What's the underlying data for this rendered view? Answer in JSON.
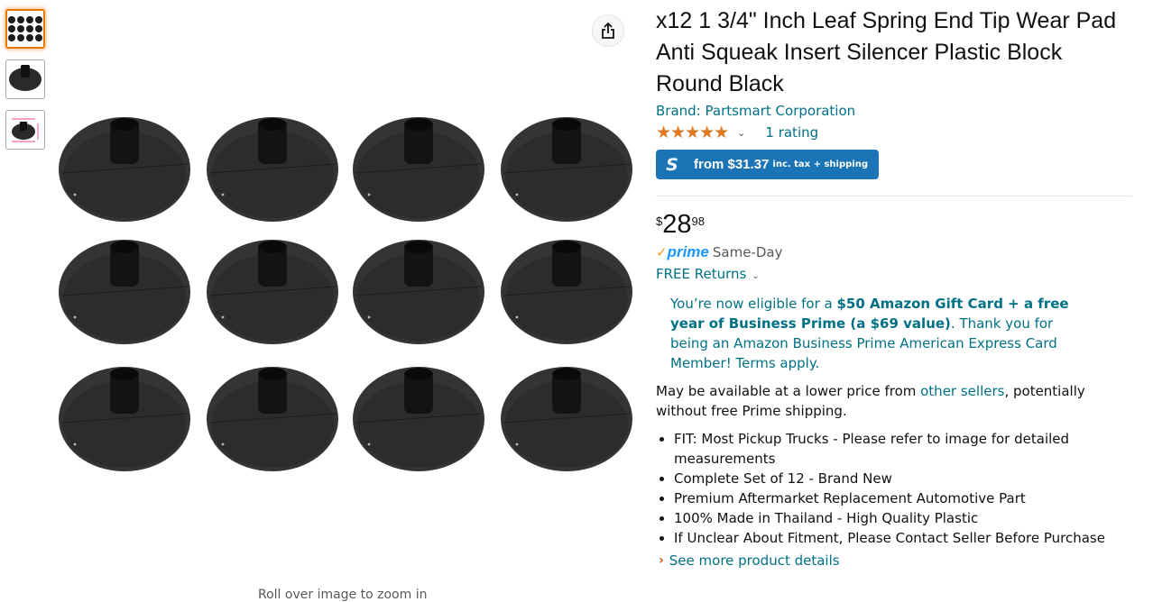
{
  "gallery": {
    "thumbnails": [
      "grid-of-pads",
      "single-pad",
      "pad-with-dimensions"
    ],
    "rollover_hint": "Roll over image to zoom in"
  },
  "product": {
    "title": "x12 1 3/4\" Inch Leaf Spring End Tip Wear Pad Anti Squeak Insert Silencer Plastic Block Round Black",
    "brand": "Brand: Partsmart Corporation",
    "stars": "★★★★★",
    "rating_value": 5,
    "rating_count": "1 rating",
    "coupon": {
      "logo": "S",
      "amount": "from $31.37",
      "note": "inc. tax + shipping"
    },
    "price": {
      "symbol": "$",
      "whole": "28",
      "fraction": "98"
    },
    "prime": {
      "check": "✓",
      "label": "prime",
      "speed": "Same-Day"
    },
    "returns": "FREE Returns",
    "promo": {
      "prefix": "You’re now eligible for a ",
      "bold": "$50 Amazon Gift Card + a free year of Business Prime (a $69 value)",
      "suffix": ". Thank you for being an Amazon Business Prime American Express Card Member! Terms apply."
    },
    "availability": {
      "prefix": "May be available at a lower price from ",
      "link": "other sellers",
      "suffix": ", potentially without free Prime shipping."
    },
    "bullets": [
      "FIT: Most Pickup Trucks - Please refer to image for detailed measurements",
      "Complete Set of 12 - Brand New",
      "Premium Aftermarket Replacement Automotive Part",
      "100% Made in Thailand - High Quality Plastic",
      "If Unclear About Fitment, Please Contact Seller Before Purchase"
    ],
    "see_more": "See more product details"
  },
  "colors": {
    "link": "#007185",
    "star": "#de7921",
    "coupon_bg": "#1a74b5",
    "prime_blue": "#1a98ff",
    "prime_check": "#fa9c1e",
    "selected_thumb": "#e77600"
  },
  "icons": {
    "share": "share-icon",
    "rating_dropdown": "chevron-down-icon",
    "returns_dropdown": "chevron-down-icon",
    "see_more": "chevron-right-icon"
  }
}
